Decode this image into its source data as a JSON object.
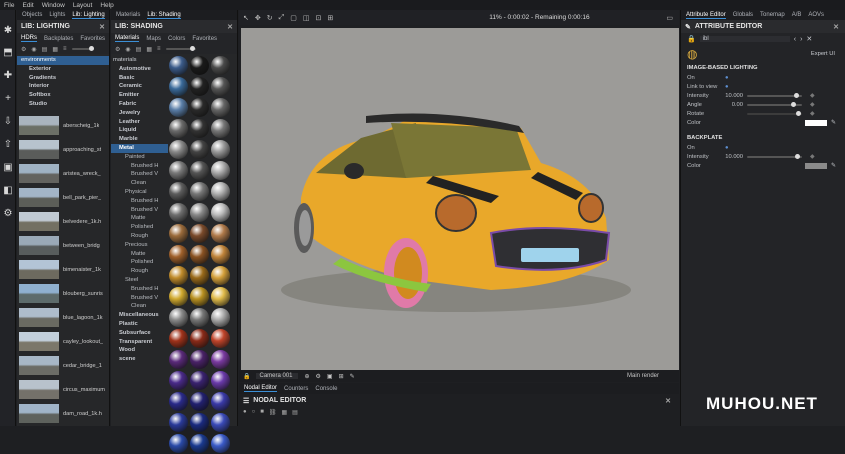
{
  "menubar": {
    "items": [
      "File",
      "Edit",
      "Window",
      "Layout",
      "Help"
    ]
  },
  "left_panel": {
    "tabs": [
      "Objects",
      "Lights",
      "Lib: Lighting"
    ],
    "title": "LIB: LIGHTING",
    "subtabs": [
      "HDRs",
      "Backplates",
      "Favorites"
    ],
    "tree": [
      "environments",
      "Exterior",
      "Gradients",
      "Interior",
      "Softbox",
      "Studio"
    ],
    "hdrs": [
      "aberscheig_1k",
      "approaching_st",
      "aristea_wreck_",
      "bell_park_pier_",
      "belvedere_1k.h",
      "between_bridg",
      "bimenaister_1k",
      "blouberg_sunris",
      "blue_lagoon_1k",
      "cayley_lookout_",
      "cedar_bridge_1",
      "circus_maximum",
      "dam_road_1k.h"
    ]
  },
  "shading_panel": {
    "tabs": [
      "Materials",
      "Lib: Shading"
    ],
    "title": "LIB: SHADING",
    "subtabs": [
      "Materials",
      "Maps",
      "Colors",
      "Favorites"
    ],
    "tree": [
      {
        "label": "materials",
        "level": 0
      },
      {
        "label": "Automotive",
        "level": 1
      },
      {
        "label": "Basic",
        "level": 1
      },
      {
        "label": "Ceramic",
        "level": 1
      },
      {
        "label": "Emitter",
        "level": 1
      },
      {
        "label": "Fabric",
        "level": 1
      },
      {
        "label": "Jewelry",
        "level": 1
      },
      {
        "label": "Leather",
        "level": 1
      },
      {
        "label": "Liquid",
        "level": 1
      },
      {
        "label": "Marble",
        "level": 1
      },
      {
        "label": "Metal",
        "level": 1,
        "selected": true
      },
      {
        "label": "Painted",
        "level": 2
      },
      {
        "label": "Brushed H",
        "level": 3
      },
      {
        "label": "Brushed V",
        "level": 3
      },
      {
        "label": "Clean",
        "level": 3
      },
      {
        "label": "Physical",
        "level": 2
      },
      {
        "label": "Brushed H",
        "level": 3
      },
      {
        "label": "Brushed V",
        "level": 3
      },
      {
        "label": "Matte",
        "level": 3
      },
      {
        "label": "Polished",
        "level": 3
      },
      {
        "label": "Rough",
        "level": 3
      },
      {
        "label": "Precious",
        "level": 2
      },
      {
        "label": "Matte",
        "level": 3
      },
      {
        "label": "Polished",
        "level": 3
      },
      {
        "label": "Rough",
        "level": 3
      },
      {
        "label": "Steel",
        "level": 2
      },
      {
        "label": "Brushed H",
        "level": 3
      },
      {
        "label": "Brushed V",
        "level": 3
      },
      {
        "label": "Clean",
        "level": 3
      },
      {
        "label": "Miscellaneous",
        "level": 1
      },
      {
        "label": "Plastic",
        "level": 1
      },
      {
        "label": "Subsurface",
        "level": 1
      },
      {
        "label": "Transparent",
        "level": 1
      },
      {
        "label": "Wood",
        "level": 1
      },
      {
        "label": "scene",
        "level": 1
      }
    ]
  },
  "viewport": {
    "progress": "11% - 0:00:02 - Remaining 0:00:16",
    "camera": "Camera 001",
    "render_mode": "Main render"
  },
  "bottom_tabs": [
    "Nodal Editor",
    "Counters",
    "Console"
  ],
  "nodal_title": "NODAL EDITOR",
  "attribute_editor": {
    "tabs": [
      "Attribute Editor",
      "Globals",
      "Tonemap",
      "A/B",
      "AOVs"
    ],
    "title": "ATTRIBUTE EDITOR",
    "object_name": "ibl",
    "expert_label": "Expert UI",
    "ibl_section": "IMAGE-BASED LIGHTING",
    "rows": [
      {
        "label": "On",
        "type": "toggle"
      },
      {
        "label": "Link to view",
        "type": "toggle"
      },
      {
        "label": "Intensity",
        "type": "slider",
        "value": "10.000",
        "level": 0.9
      },
      {
        "label": "Angle",
        "type": "slider",
        "value": "0.00",
        "level": 0.85
      },
      {
        "label": "Rotate",
        "type": "slider-dim",
        "value": "",
        "level": 0.95
      },
      {
        "label": "Color",
        "type": "swatch",
        "color": "#ffffff"
      }
    ],
    "backplate_section": "BACKPLATE",
    "backplate_rows": [
      {
        "label": "On",
        "type": "toggle"
      },
      {
        "label": "Intensity",
        "type": "slider",
        "value": "10.000",
        "level": 0.92
      },
      {
        "label": "Color",
        "type": "swatch",
        "color": "#8a8a8a"
      }
    ]
  },
  "watermark": "MUHOU.NET",
  "colors": {
    "accent": "#3b8fd6",
    "car_body": "#e9a82a",
    "bg": "#9c9b98"
  }
}
